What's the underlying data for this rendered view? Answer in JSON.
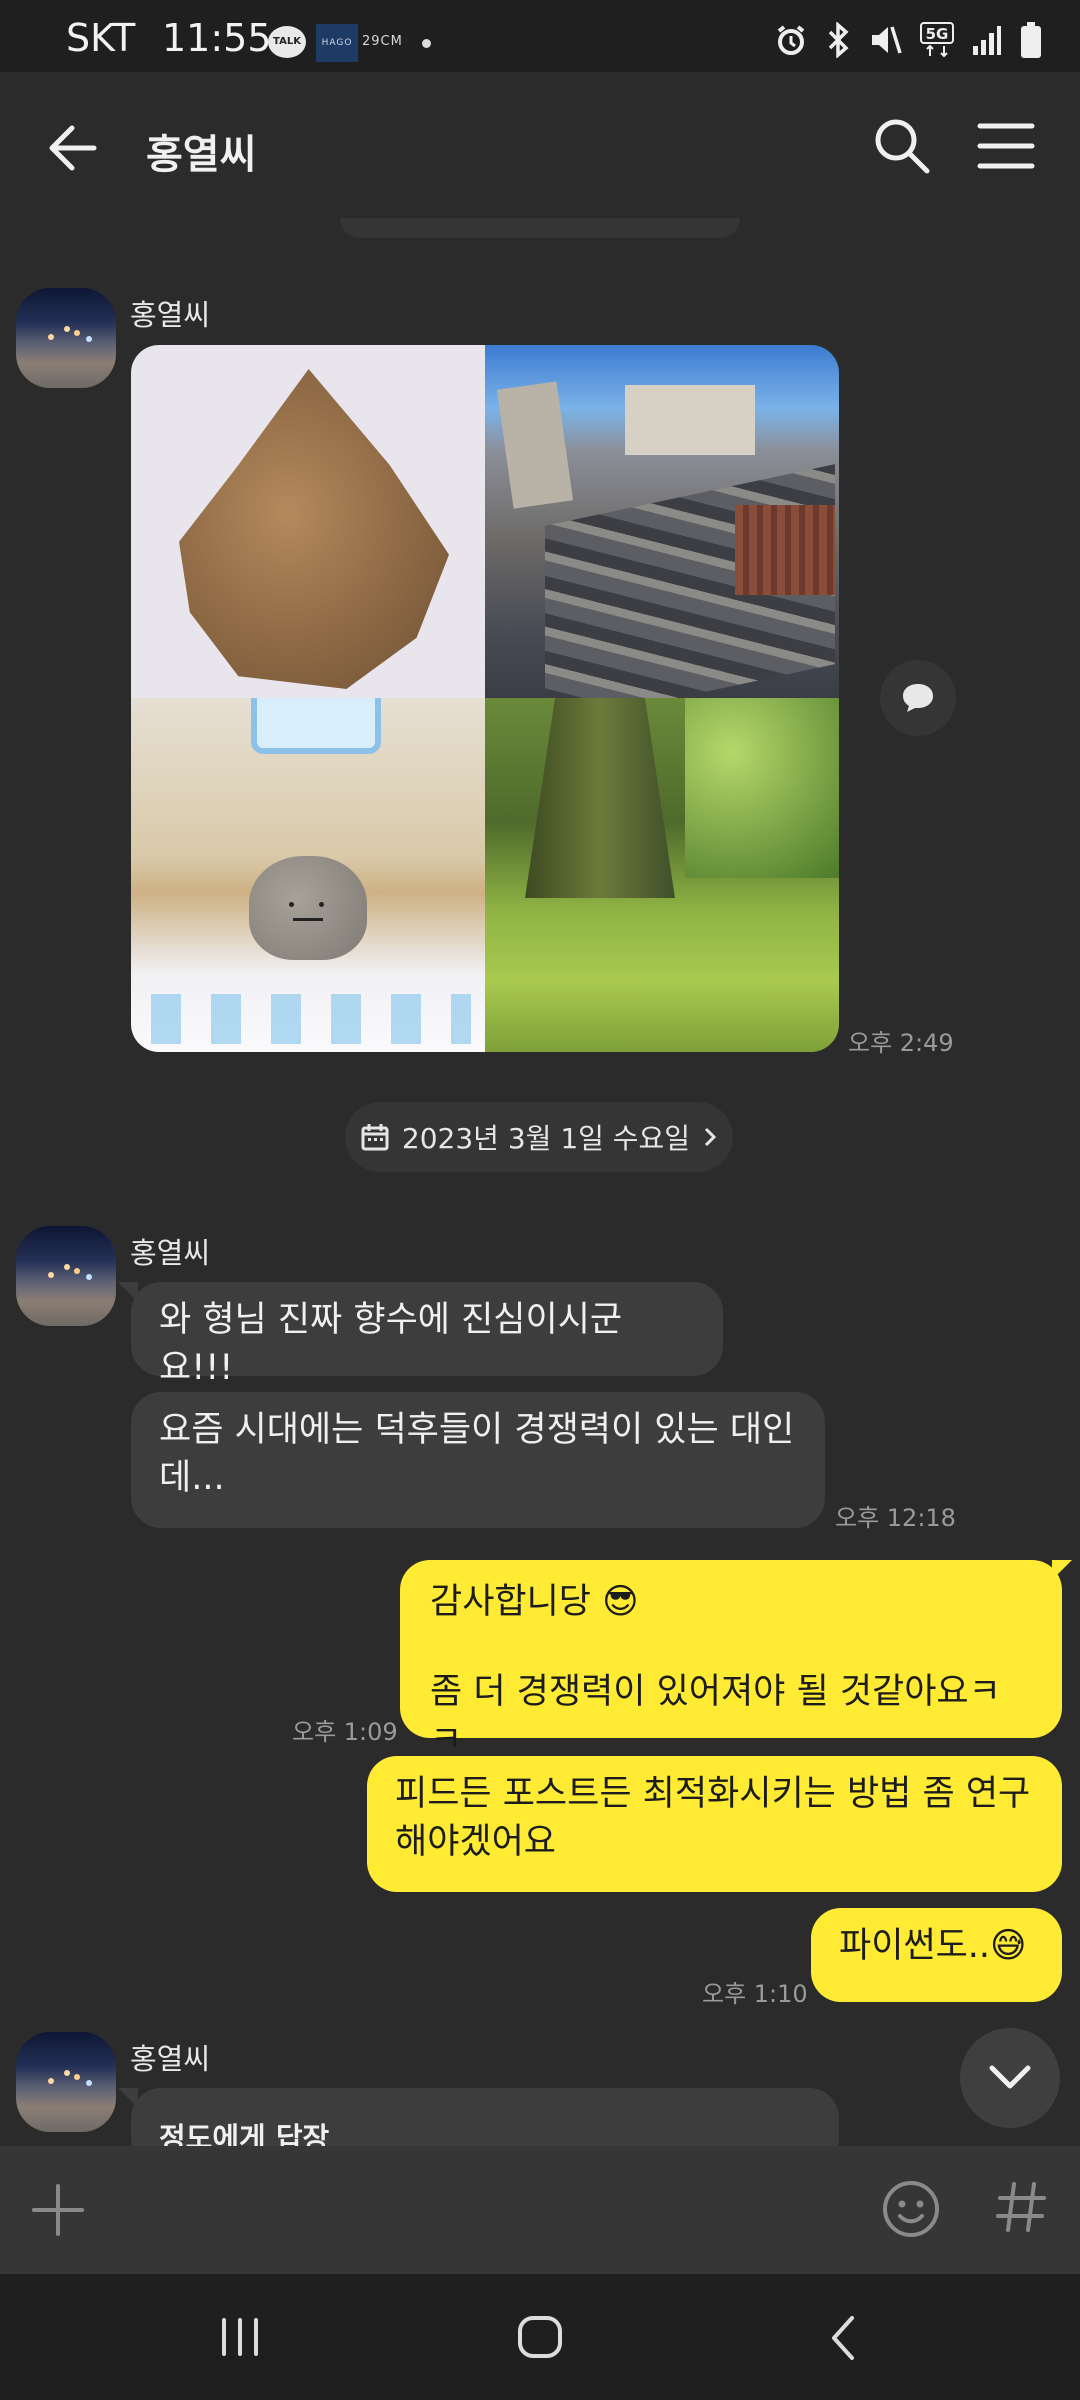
{
  "status_bar": {
    "carrier": "SKT",
    "time": "11:55",
    "talk_badge": "TALK",
    "hago_badge": "HAGO",
    "app_label": "29CM",
    "network": "5G"
  },
  "header": {
    "title": "홍열씨"
  },
  "messages": [
    {
      "sender": "홍열씨",
      "type": "photo_grid",
      "time": "오후 2:49"
    },
    {
      "date_divider": "2023년 3월 1일 수요일"
    },
    {
      "sender": "홍열씨",
      "texts": [
        "와 형님 진짜 향수에 진심이시군요!!!",
        "요즘 시대에는 덕후들이 경쟁력이 있는 대인데..."
      ],
      "time": "오후 12:18"
    },
    {
      "sender": "me",
      "text_line1": "감사합니당 😎",
      "text_line2": "좀 더 경쟁력이 있어져야 될 것같아요ㅋㅋ",
      "time": "오후 1:09"
    },
    {
      "sender": "me",
      "text": "피드든 포스트든 최적화시키는 방법 좀 연구해야겠어요"
    },
    {
      "sender": "me",
      "text": "파이썬도..😅",
      "time": "오후 1:10"
    },
    {
      "sender": "홍열씨",
      "reply_preview": "정도에게 답장"
    }
  ],
  "colors": {
    "background": "#2b2b2b",
    "incoming_bubble": "#3d3d3d",
    "outgoing_bubble": "#ffeb33"
  }
}
